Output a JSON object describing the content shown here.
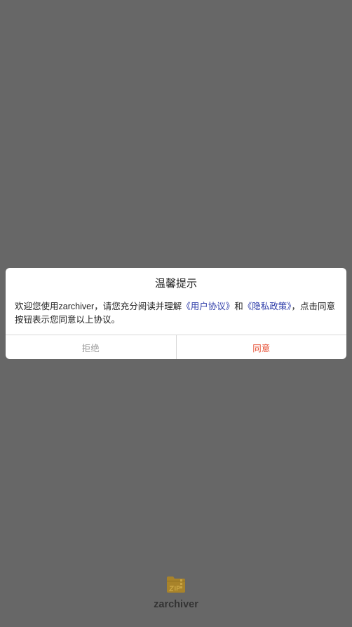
{
  "dialog": {
    "title": "温馨提示",
    "message_prefix": "欢迎您使用zarchiver，请您充分阅读并理解",
    "user_agreement_link": "《用户协议》",
    "connector": "和",
    "privacy_policy_link": "《隐私政策》",
    "message_suffix": "，点击同意按钮表示您同意以上协议。",
    "reject_label": "拒绝",
    "agree_label": "同意"
  },
  "app": {
    "icon": "zip-folder-icon",
    "name": "zarchiver"
  },
  "colors": {
    "overlay": "#676767",
    "dialog_bg": "#ffffff",
    "link": "#2b3aa8",
    "agree": "#e64a2e",
    "reject": "#9a9a9a",
    "icon": "#a8832a"
  }
}
